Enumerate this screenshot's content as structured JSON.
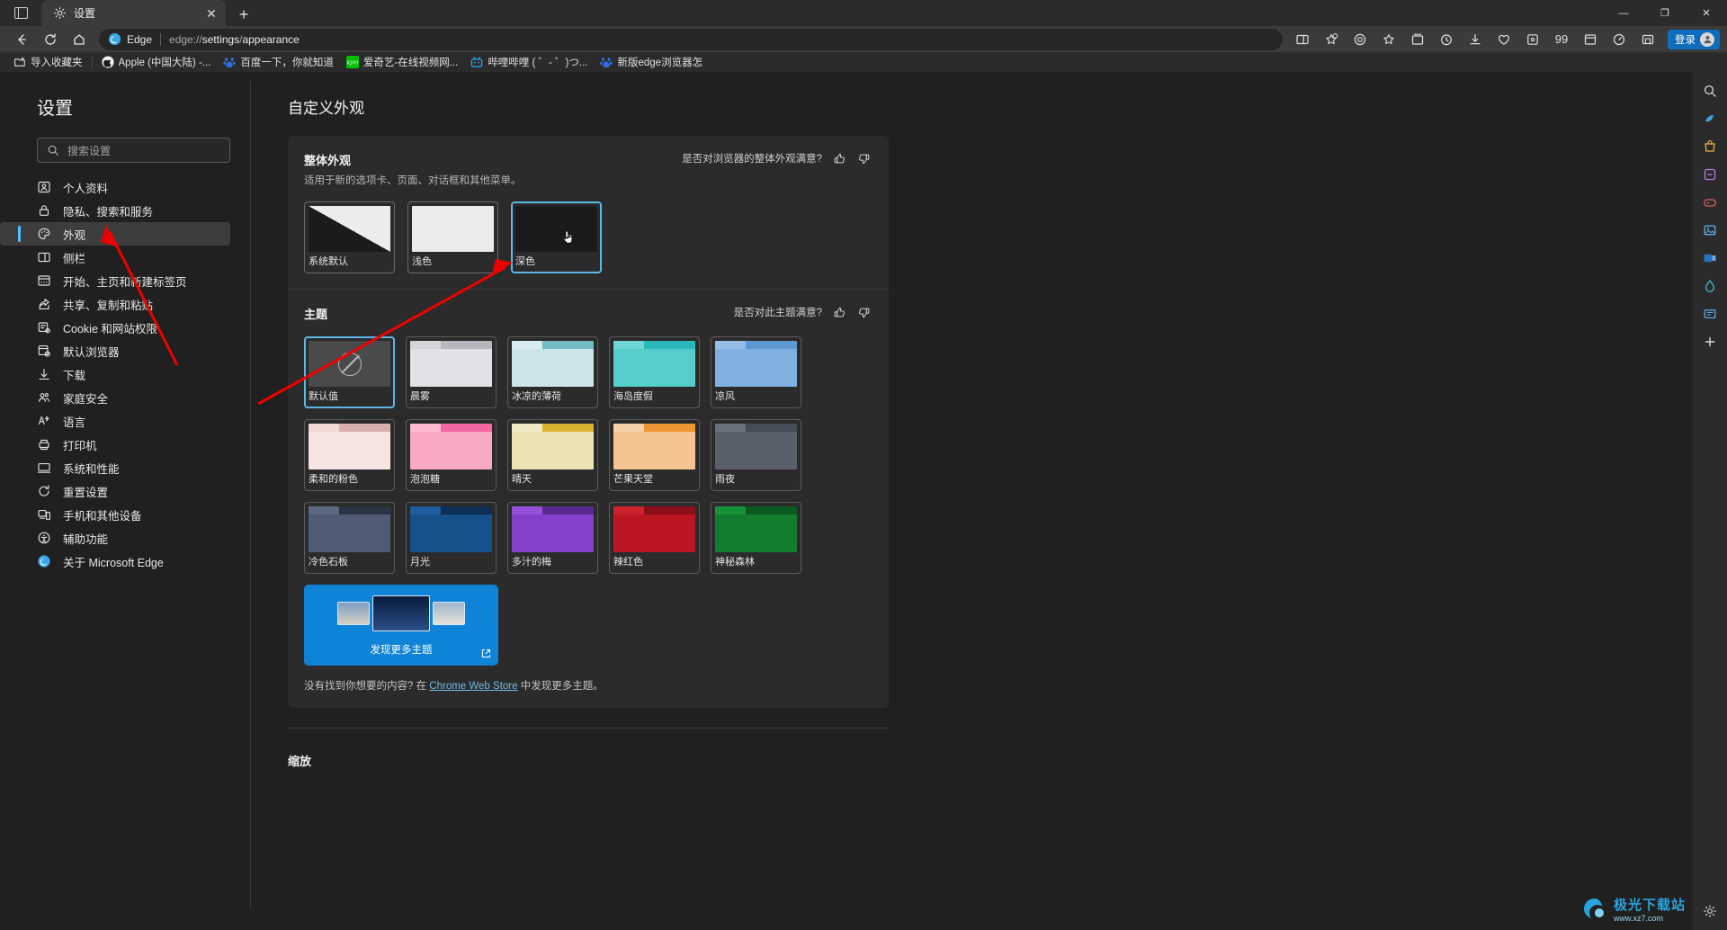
{
  "window": {
    "tab_title": "设置",
    "tab_icon": "gear-icon",
    "new_tab_label": "+",
    "close_label": "✕",
    "minimize": "—",
    "maximize": "❐",
    "window_close": "✕"
  },
  "toolbar": {
    "back": "←",
    "refresh": "↻",
    "home": "⌂",
    "edge_label": "Edge",
    "url_prefix": "edge://",
    "url_bold1": "settings",
    "url_mid": "/",
    "url_bold2": "appearance",
    "url_full": "edge://settings/appearance",
    "signin_label": "登录",
    "icons": [
      "split-screen-icon",
      "favorite-star-icon",
      "copilot-icon",
      "favorites-icon",
      "collections-icon",
      "history-icon",
      "downloads-icon",
      "browser-essentials-icon",
      "extensions-icon",
      "quote-icon",
      "workspaces-icon",
      "performance-icon",
      "screenshot-icon"
    ]
  },
  "bookmarks": [
    {
      "label": "导入收藏夹",
      "icon": "import-folder-icon"
    },
    {
      "label": "Apple (中国大陆) -...",
      "icon": "apple-icon"
    },
    {
      "label": "百度一下，你就知道",
      "icon": "baidu-icon"
    },
    {
      "label": "爱奇艺-在线视频网...",
      "icon": "iqiyi-icon"
    },
    {
      "label": "哔哩哔哩 ( ゜- ゜)つ...",
      "icon": "bilibili-icon"
    },
    {
      "label": "新版edge浏览器怎",
      "icon": "baidu-icon"
    }
  ],
  "sidebar_rail": [
    "search-icon",
    "copilot-icon",
    "shopping-icon",
    "tools-icon",
    "games-icon",
    "outlook-icon",
    "office-icon",
    "drop-icon",
    "feed-icon",
    "add-icon"
  ],
  "nav": {
    "title": "设置",
    "search_placeholder": "搜索设置",
    "items": [
      {
        "label": "个人资料",
        "icon": "profile-icon",
        "active": false
      },
      {
        "label": "隐私、搜索和服务",
        "icon": "lock-icon",
        "active": false
      },
      {
        "label": "外观",
        "icon": "palette-icon",
        "active": true
      },
      {
        "label": "侧栏",
        "icon": "sidebar-icon",
        "active": false
      },
      {
        "label": "开始、主页和新建标签页",
        "icon": "startpage-icon",
        "active": false
      },
      {
        "label": "共享、复制和粘贴",
        "icon": "share-icon",
        "active": false
      },
      {
        "label": "Cookie 和网站权限",
        "icon": "cookie-icon",
        "active": false
      },
      {
        "label": "默认浏览器",
        "icon": "default-browser-icon",
        "active": false
      },
      {
        "label": "下载",
        "icon": "download-icon",
        "active": false
      },
      {
        "label": "家庭安全",
        "icon": "family-icon",
        "active": false
      },
      {
        "label": "语言",
        "icon": "language-icon",
        "active": false
      },
      {
        "label": "打印机",
        "icon": "printer-icon",
        "active": false
      },
      {
        "label": "系统和性能",
        "icon": "system-icon",
        "active": false
      },
      {
        "label": "重置设置",
        "icon": "reset-icon",
        "active": false
      },
      {
        "label": "手机和其他设备",
        "icon": "devices-icon",
        "active": false
      },
      {
        "label": "辅助功能",
        "icon": "accessibility-icon",
        "active": false
      },
      {
        "label": "关于 Microsoft Edge",
        "icon": "edge-icon",
        "active": false
      }
    ]
  },
  "page": {
    "title": "自定义外观",
    "overall": {
      "title": "整体外观",
      "desc": "适用于新的选项卡、页面、对话框和其他菜单。",
      "feedback_text": "是否对浏览器的整体外观满意?",
      "thumb_up": "thumbs-up-icon",
      "thumb_down": "thumbs-down-icon",
      "options": [
        {
          "label": "系统默认",
          "type": "system",
          "selected": false
        },
        {
          "label": "浅色",
          "type": "light",
          "selected": false
        },
        {
          "label": "深色",
          "type": "dark",
          "selected": true
        }
      ]
    },
    "themes": {
      "title": "主题",
      "feedback_text": "是否对此主题满意?",
      "thumb_up": "thumbs-up-icon",
      "thumb_down": "thumbs-down-icon",
      "items": [
        {
          "label": "默认值",
          "selected": true,
          "body": "#4a4a4a",
          "top": "#3c3c3c",
          "tab": "#555555",
          "default": true
        },
        {
          "label": "晨雾",
          "selected": false,
          "body": "#e2e2e6",
          "top": "#b6b8bd",
          "tab": "#d5d6da"
        },
        {
          "label": "冰凉的薄荷",
          "selected": false,
          "body": "#cce5e8",
          "top": "#74b9c4",
          "tab": "#d8ecef"
        },
        {
          "label": "海岛度假",
          "selected": false,
          "body": "#55cdcb",
          "top": "#2bb9bb",
          "tab": "#6ed7d5"
        },
        {
          "label": "凉风",
          "selected": false,
          "body": "#7fb0e0",
          "top": "#5e9ad4",
          "tab": "#93bce6"
        },
        {
          "label": "柔和的粉色",
          "selected": false,
          "body": "#f6e5e3",
          "top": "#d8b0ab",
          "tab": "#f1d8d4"
        },
        {
          "label": "泡泡糖",
          "selected": false,
          "body": "#f9a8c6",
          "top": "#f267a1",
          "tab": "#fbb9d2"
        },
        {
          "label": "晴天",
          "selected": false,
          "body": "#ece3b4",
          "top": "#d9b030",
          "tab": "#efe9c4"
        },
        {
          "label": "芒果天堂",
          "selected": false,
          "body": "#f3c391",
          "top": "#ef9634",
          "tab": "#f6d0a8"
        },
        {
          "label": "雨夜",
          "selected": false,
          "body": "#5a606b",
          "top": "#464c57",
          "tab": "#6b717c"
        },
        {
          "label": "冷色石板",
          "selected": false,
          "body": "#4f5b74",
          "top": "#2b3443",
          "tab": "#5c6980"
        },
        {
          "label": "月光",
          "selected": false,
          "body": "#18508c",
          "top": "#0e2e55",
          "tab": "#1e5c9e"
        },
        {
          "label": "多汁的梅",
          "selected": false,
          "body": "#8540c9",
          "top": "#5a2b8c",
          "tab": "#9550d8"
        },
        {
          "label": "辣红色",
          "selected": false,
          "body": "#bb1622",
          "top": "#8a0f19",
          "tab": "#cc222e"
        },
        {
          "label": "神秘森林",
          "selected": false,
          "body": "#127d2e",
          "top": "#0b5a21",
          "tab": "#179238"
        }
      ],
      "discover_label": "发现更多主题",
      "discover_ext_icon": "external-link-icon",
      "store_note_prefix": "没有找到你想要的内容? 在 ",
      "store_note_link": "Chrome Web Store",
      "store_note_suffix": " 中发现更多主题。"
    },
    "zoom_title": "缩放"
  },
  "watermark": {
    "main": "极光下载站",
    "sub": "www.xz7.com"
  }
}
